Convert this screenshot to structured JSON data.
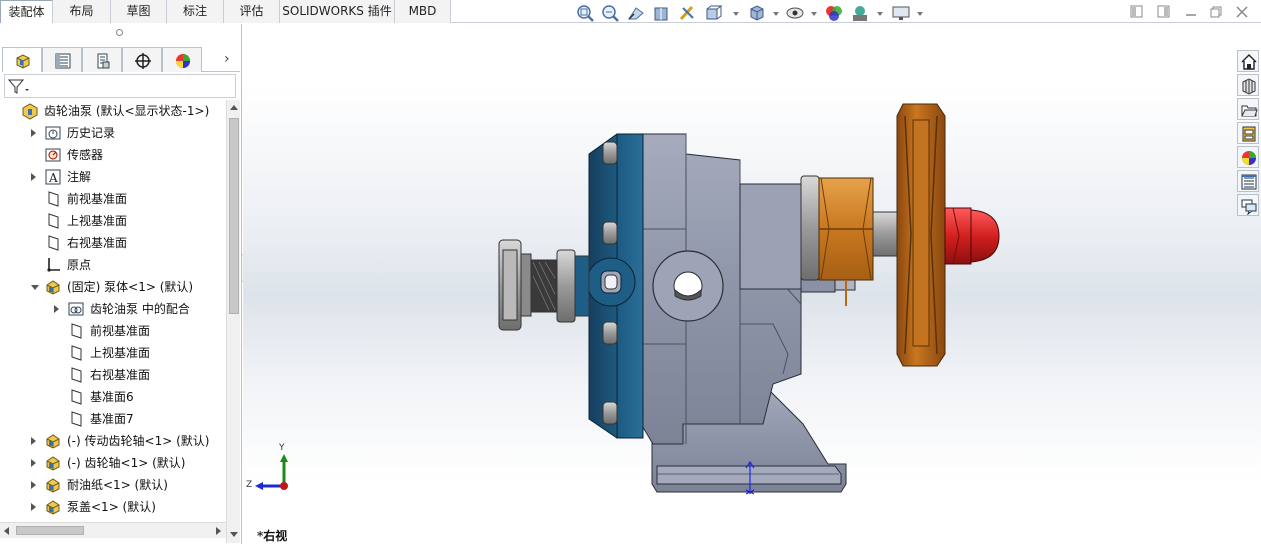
{
  "command_manager": {
    "tabs": [
      {
        "label": "装配体",
        "active": true
      },
      {
        "label": "布局"
      },
      {
        "label": "草图"
      },
      {
        "label": "标注"
      },
      {
        "label": "评估"
      },
      {
        "label": "SOLIDWORKS 插件"
      },
      {
        "label": "MBD"
      }
    ]
  },
  "heads_up_toolbar": {
    "icons": [
      "zoom-to-fit-icon",
      "zoom-to-area-icon",
      "previous-view-icon",
      "section-view-icon",
      "dynamic-annotation-icon",
      "view-orientation-icon",
      "display-style-icon",
      "hide-show-items-icon",
      "edit-appearance-icon",
      "apply-scene-icon",
      "view-settings-icon"
    ]
  },
  "window_controls": {
    "icons": [
      "tile-left-icon",
      "tile-right-icon",
      "restore-icon",
      "close-icon"
    ]
  },
  "left_panel": {
    "tabs": [
      "featuremanager-icon",
      "propertymanager-icon",
      "configurationmanager-icon",
      "dimxpertmanager-icon",
      "displaymanager-icon"
    ],
    "more_arrow": "›",
    "filter_icon": "filter-icon",
    "tree": [
      {
        "label": "齿轮油泵  (默认<显示状态-1>)",
        "icon": "assembly-icon",
        "indent": 0,
        "expander": "none"
      },
      {
        "label": "历史记录",
        "icon": "history-icon",
        "indent": 1,
        "expander": "collapsed"
      },
      {
        "label": "传感器",
        "icon": "sensor-icon",
        "indent": 1,
        "expander": "none"
      },
      {
        "label": "注解",
        "icon": "annotation-icon",
        "indent": 1,
        "expander": "collapsed"
      },
      {
        "label": "前视基准面",
        "icon": "plane-icon",
        "indent": 1,
        "expander": "none"
      },
      {
        "label": "上视基准面",
        "icon": "plane-icon",
        "indent": 1,
        "expander": "none"
      },
      {
        "label": "右视基准面",
        "icon": "plane-icon",
        "indent": 1,
        "expander": "none"
      },
      {
        "label": "原点",
        "icon": "origin-icon",
        "indent": 1,
        "expander": "none"
      },
      {
        "label": "(固定) 泵体<1> (默认)",
        "icon": "part-icon",
        "indent": 1,
        "expander": "expanded"
      },
      {
        "label": "齿轮油泵 中的配合",
        "icon": "mates-icon",
        "indent": 2,
        "expander": "collapsed"
      },
      {
        "label": "前视基准面",
        "icon": "plane-icon",
        "indent": 2,
        "expander": "none"
      },
      {
        "label": "上视基准面",
        "icon": "plane-icon",
        "indent": 2,
        "expander": "none"
      },
      {
        "label": "右视基准面",
        "icon": "plane-icon",
        "indent": 2,
        "expander": "none"
      },
      {
        "label": "基准面6",
        "icon": "plane-icon",
        "indent": 2,
        "expander": "none"
      },
      {
        "label": "基准面7",
        "icon": "plane-icon",
        "indent": 2,
        "expander": "none"
      },
      {
        "label": "(-) 传动齿轮轴<1> (默认)",
        "icon": "part-icon",
        "indent": 1,
        "expander": "collapsed"
      },
      {
        "label": "(-) 齿轮轴<1> (默认)",
        "icon": "part-icon",
        "indent": 1,
        "expander": "collapsed"
      },
      {
        "label": "耐油纸<1> (默认)",
        "icon": "part-icon",
        "indent": 1,
        "expander": "collapsed"
      },
      {
        "label": "泵盖<1> (默认)",
        "icon": "part-icon",
        "indent": 1,
        "expander": "collapsed"
      }
    ]
  },
  "viewport": {
    "view_label": "*右视",
    "triad": {
      "y": "Y",
      "z": "Z"
    }
  },
  "task_pane": {
    "icons": [
      "home-icon",
      "design-library-icon",
      "file-explorer-icon",
      "view-palette-icon",
      "appearances-icon",
      "custom-properties-icon",
      "forum-icon"
    ]
  },
  "colors": {
    "pump_body": "#8f95a8",
    "pump_cover": "#1e5e86",
    "pulley": "#b8661a",
    "nut": "#d18a2a",
    "cap": "#d32020"
  }
}
